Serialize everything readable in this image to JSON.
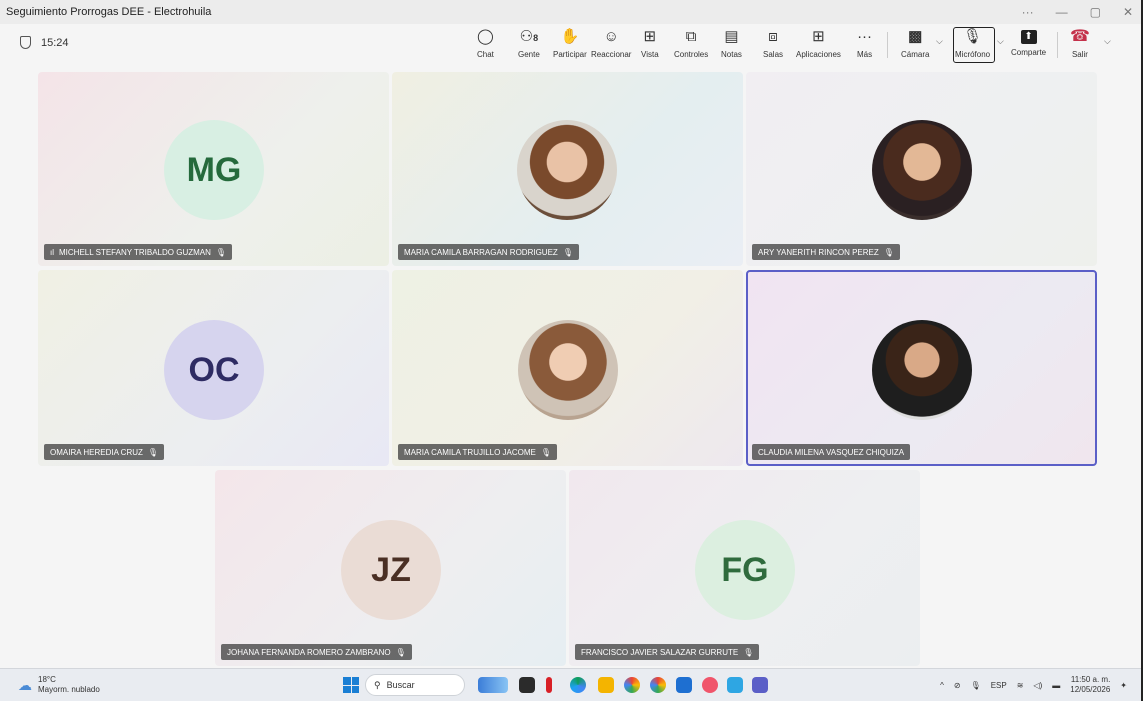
{
  "window": {
    "title": "Seguimiento Prorrogas DEE - Electrohuila",
    "controls": [
      "···",
      "—",
      "▢",
      "✕"
    ]
  },
  "toolbar": {
    "timer": "15:24",
    "buttons": [
      {
        "label": "Chat",
        "icon": "chat-icon",
        "glyph": "☺"
      },
      {
        "label": "Gente",
        "icon": "people-icon",
        "glyph": "⚇",
        "badge": "8"
      },
      {
        "label": "Participar",
        "icon": "raise-hand-icon",
        "glyph": "✋"
      },
      {
        "label": "Reaccionar",
        "icon": "smile-icon",
        "glyph": "☺"
      },
      {
        "label": "Vista",
        "icon": "grid-view-icon",
        "glyph": "⊞"
      },
      {
        "label": "Controles",
        "icon": "controls-icon",
        "glyph": "⧉"
      },
      {
        "label": "Notas",
        "icon": "notes-icon",
        "glyph": "▤"
      },
      {
        "label": "Salas",
        "icon": "rooms-icon",
        "glyph": "⧈"
      },
      {
        "label": "Aplicaciones",
        "icon": "apps-add-icon",
        "glyph": "⊞"
      },
      {
        "label": "Más",
        "icon": "more-icon",
        "glyph": "···"
      },
      {
        "label": "Cámara",
        "icon": "camera-off-icon",
        "glyph": "▩"
      },
      {
        "label": "Micrófono",
        "icon": "mic-off-icon",
        "glyph": "🎙"
      },
      {
        "label": "Comparte",
        "icon": "share-icon",
        "glyph": "⬆"
      },
      {
        "label": "Salir",
        "icon": "hangup-icon",
        "glyph": "☎"
      }
    ],
    "people_badge": "8"
  },
  "participants": [
    {
      "name": "MICHELL STEFANY TRIBALDO GUZMAN",
      "initials": "MG",
      "avatar_bg": "#d8efe3",
      "initials_color": "#256a3c",
      "signal": "ıl"
    },
    {
      "name": "MARIA CAMILA BARRAGAN RODRIGUEZ",
      "initials": "",
      "photo": true
    },
    {
      "name": "ARY YANERITH RINCON PEREZ",
      "initials": "",
      "photo": true
    },
    {
      "name": "OMAIRA HEREDIA CRUZ",
      "initials": "OC",
      "avatar_bg": "#d6d4ee",
      "initials_color": "#2e2b63"
    },
    {
      "name": "MARIA CAMILA TRUJILLO JACOME",
      "initials": "",
      "photo": true
    },
    {
      "name": "CLAUDIA MILENA VASQUEZ CHIQUIZA",
      "initials": "",
      "photo": true,
      "active": true
    },
    {
      "name": "JOHANA FERNANDA ROMERO ZAMBRANO",
      "initials": "JZ",
      "avatar_bg": "#eadcd5",
      "initials_color": "#4a2f24"
    },
    {
      "name": "FRANCISCO JAVIER SALAZAR GURRUTE",
      "initials": "FG",
      "avatar_bg": "#dcefe0",
      "initials_color": "#2f6b3d"
    }
  ],
  "taskbar": {
    "weather_temp": "18°C",
    "weather_desc": "Mayorm. nublado",
    "search_placeholder": "Buscar",
    "language": "ESP",
    "time": "11:50 a. m.",
    "date": "12/05/2026",
    "colors": {
      "accent": "#5b5fc7",
      "hangup": "#c4314b"
    }
  }
}
